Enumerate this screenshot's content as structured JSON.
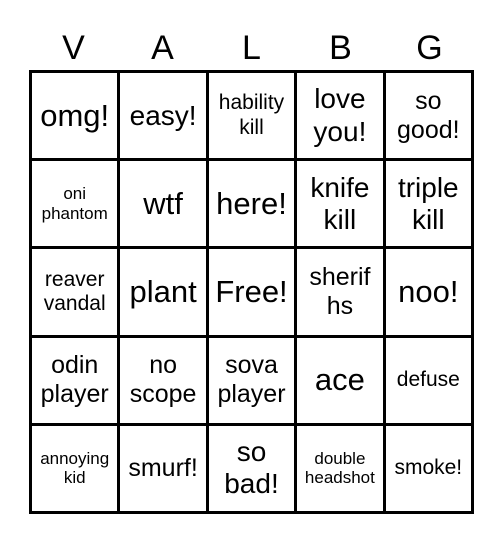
{
  "header": {
    "letters": [
      "V",
      "A",
      "L",
      "B",
      "G"
    ]
  },
  "cells": [
    {
      "text": "omg!",
      "size": "xl"
    },
    {
      "text": "easy!",
      "size": "l"
    },
    {
      "text": "hability kill",
      "size": "s"
    },
    {
      "text": "love you!",
      "size": "l"
    },
    {
      "text": "so good!",
      "size": "m"
    },
    {
      "text": "oni phantom",
      "size": "xs"
    },
    {
      "text": "wtf",
      "size": "xl"
    },
    {
      "text": "here!",
      "size": "xl"
    },
    {
      "text": "knife kill",
      "size": "l"
    },
    {
      "text": "triple kill",
      "size": "l"
    },
    {
      "text": "reaver vandal",
      "size": "s"
    },
    {
      "text": "plant",
      "size": "xl"
    },
    {
      "text": "Free!",
      "size": "xl"
    },
    {
      "text": "sherif hs",
      "size": "m"
    },
    {
      "text": "noo!",
      "size": "xl"
    },
    {
      "text": "odin player",
      "size": "m"
    },
    {
      "text": "no scope",
      "size": "m"
    },
    {
      "text": "sova player",
      "size": "m"
    },
    {
      "text": "ace",
      "size": "xl"
    },
    {
      "text": "defuse",
      "size": "s"
    },
    {
      "text": "annoying kid",
      "size": "xs"
    },
    {
      "text": "smurf!",
      "size": "m"
    },
    {
      "text": "so bad!",
      "size": "l"
    },
    {
      "text": "double headshot",
      "size": "xs"
    },
    {
      "text": "smoke!",
      "size": "s"
    }
  ]
}
